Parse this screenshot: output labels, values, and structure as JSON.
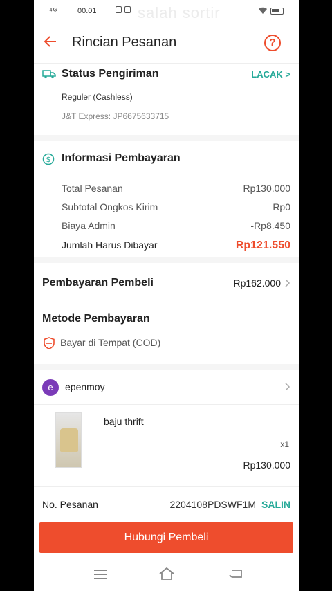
{
  "status_bar": {
    "time": "00.01",
    "signal": "⁴ᴳ",
    "overlay_text": "salah sortir"
  },
  "header": {
    "title": "Rincian Pesanan",
    "help_symbol": "?"
  },
  "shipping": {
    "title": "Status Pengiriman",
    "track_label": "LACAK >",
    "service": "Reguler (Cashless)",
    "courier_tracking": "J&T Express: JP6675633715"
  },
  "payment_info": {
    "title": "Informasi Pembayaran",
    "rows": [
      {
        "label": "Total Pesanan",
        "value": "Rp130.000"
      },
      {
        "label": "Subtotal Ongkos Kirim",
        "value": "Rp0"
      },
      {
        "label": "Biaya Admin",
        "value": "-Rp8.450"
      }
    ],
    "total": {
      "label": "Jumlah Harus Dibayar",
      "value": "Rp121.550"
    }
  },
  "buyer_payment": {
    "title": "Pembayaran Pembeli",
    "amount": "Rp162.000"
  },
  "payment_method": {
    "title": "Metode Pembayaran",
    "method": "Bayar di Tempat (COD)"
  },
  "seller": {
    "avatar_letter": "e",
    "name": "epenmoy"
  },
  "product": {
    "name": "baju thrift",
    "qty": "x1",
    "price": "Rp130.000"
  },
  "order": {
    "label": "No. Pesanan",
    "number": "2204108PDSWF1M",
    "copy_label": "SALIN"
  },
  "cta": {
    "label": "Hubungi Pembeli"
  },
  "colors": {
    "accent": "#ee4d2d",
    "teal": "#26aa99",
    "avatar": "#7b3bb8"
  },
  "icons": [
    "back-arrow-icon",
    "help-icon",
    "truck-icon",
    "dollar-circle-icon",
    "shield-icon",
    "chevron-right-icon",
    "menu-icon",
    "home-icon",
    "back-nav-icon"
  ]
}
